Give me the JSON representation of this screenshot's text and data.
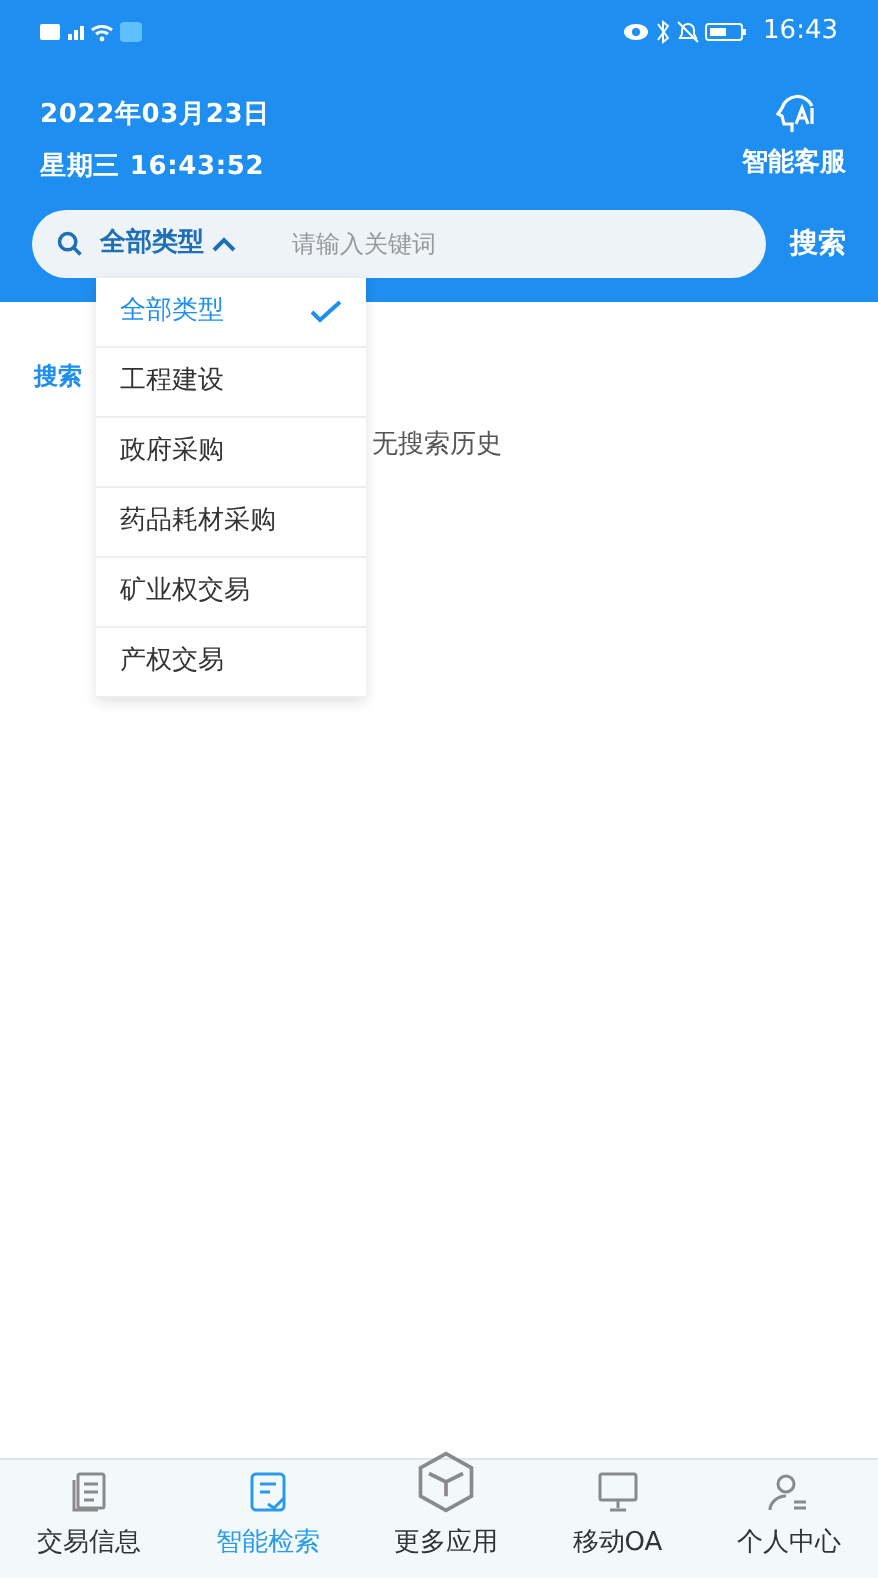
{
  "status_bar": {
    "time": "16:43"
  },
  "header": {
    "date": "2022年03月23日",
    "datetime": "星期三 16:43:52",
    "service_label": "智能客服"
  },
  "search": {
    "type_label": "全部类型",
    "placeholder": "请输入关键词",
    "button": "搜索"
  },
  "history": {
    "title": "搜索",
    "empty_text": "无搜索历史"
  },
  "dropdown": [
    {
      "label": "全部类型",
      "selected": true
    },
    {
      "label": "工程建设",
      "selected": false
    },
    {
      "label": "政府采购",
      "selected": false
    },
    {
      "label": "药品耗材采购",
      "selected": false
    },
    {
      "label": "矿业权交易",
      "selected": false
    },
    {
      "label": "产权交易",
      "selected": false
    }
  ],
  "tabs": [
    {
      "label": "交易信息",
      "selected": false,
      "kind": "doc"
    },
    {
      "label": "智能检索",
      "selected": true,
      "kind": "search"
    },
    {
      "label": "更多应用",
      "selected": false,
      "kind": "cube"
    },
    {
      "label": "移动OA",
      "selected": false,
      "kind": "oa"
    },
    {
      "label": "个人中心",
      "selected": false,
      "kind": "user"
    }
  ]
}
